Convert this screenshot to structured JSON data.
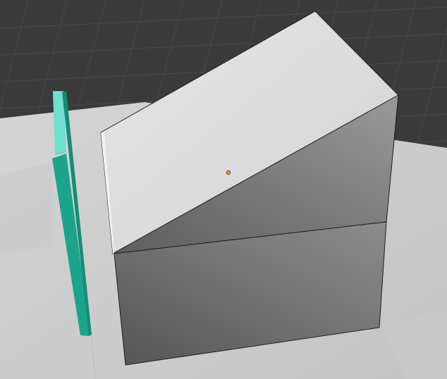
{
  "viewport": {
    "background": "#3a3a3a",
    "grid_line_color": "#484848",
    "axis_x_color": "#8a2f36"
  },
  "scene": {
    "ground_plane": {
      "color": "#cdcdcd"
    },
    "wedge_object": {
      "top_face_color": "#dcdcdc",
      "side_face_color": "#808080",
      "edge_color": "#1f1f1f",
      "origin_dot_color": "#e8922f"
    },
    "selected_panel": {
      "front_color": "#1aa58a",
      "top_color": "#6fe0cc",
      "side_color": "#158d76"
    }
  }
}
